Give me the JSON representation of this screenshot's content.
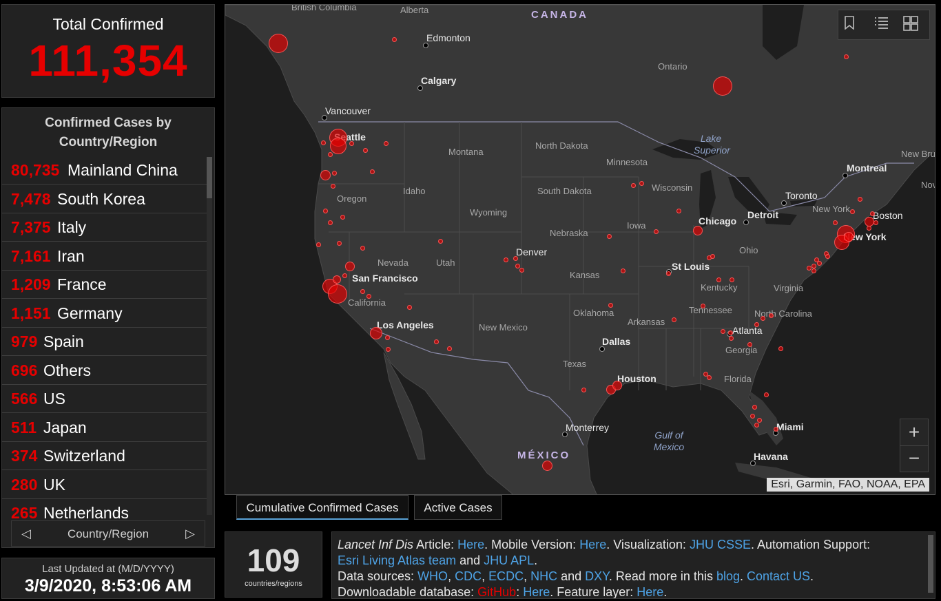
{
  "total": {
    "label": "Total Confirmed",
    "value": "111,354"
  },
  "list": {
    "heading_line1": "Confirmed Cases by",
    "heading_line2": "Country/Region",
    "rows": [
      {
        "num": "80,735",
        "name": "Mainland China"
      },
      {
        "num": "7,478",
        "name": "South Korea"
      },
      {
        "num": "7,375",
        "name": "Italy"
      },
      {
        "num": "7,161",
        "name": "Iran"
      },
      {
        "num": "1,209",
        "name": "France"
      },
      {
        "num": "1,151",
        "name": "Germany"
      },
      {
        "num": "979",
        "name": "Spain"
      },
      {
        "num": "696",
        "name": "Others"
      },
      {
        "num": "566",
        "name": "US"
      },
      {
        "num": "511",
        "name": "Japan"
      },
      {
        "num": "374",
        "name": "Switzerland"
      },
      {
        "num": "280",
        "name": "UK"
      },
      {
        "num": "265",
        "name": "Netherlands"
      }
    ],
    "pager_label": "Country/Region",
    "prev_icon": "◁",
    "next_icon": "▷"
  },
  "updated": {
    "label": "Last Updated at (M/D/YYYY)",
    "value": "3/9/2020, 8:53:06 AM"
  },
  "map": {
    "countries": {
      "canada": "CANADA",
      "mexico": "MÉXICO"
    },
    "regions": {
      "british_columbia": "British Columbia",
      "alberta": "Alberta",
      "ontario": "Ontario",
      "montana": "Montana",
      "north_dakota": "North Dakota",
      "minnesota": "Minnesota",
      "idaho": "Idaho",
      "south_dakota": "South Dakota",
      "wisconsin": "Wisconsin",
      "oregon": "Oregon",
      "wyoming": "Wyoming",
      "iowa": "Iowa",
      "nebraska": "Nebraska",
      "nevada": "Nevada",
      "utah": "Utah",
      "ohio": "Ohio",
      "kansas": "Kansas",
      "kentucky": "Kentucky",
      "virginia": "Virginia",
      "california": "California",
      "tennessee": "Tennessee",
      "north_carolina": "North Carolina",
      "oklahoma": "Oklahoma",
      "arkansas": "Arkansas",
      "new_mexico": "New Mexico",
      "georgia": "Georgia",
      "texas": "Texas",
      "florida": "Florida",
      "new_york_state": "New York",
      "new_brunswick": "New Brunswi",
      "nova": "Nov"
    },
    "cities": {
      "edmonton": "Edmonton",
      "calgary": "Calgary",
      "vancouver": "Vancouver",
      "seattle": "Seattle",
      "montreal": "Montreal",
      "toronto": "Toronto",
      "boston": "Boston",
      "detroit": "Detroit",
      "chicago": "Chicago",
      "new_york": "New York",
      "denver": "Denver",
      "st_louis": "St Louis",
      "san_francisco": "San Francisco",
      "los_angeles": "Los Angeles",
      "dallas": "Dallas",
      "atlanta": "Atlanta",
      "houston": "Houston",
      "monterrey": "Monterrey",
      "miami": "Miami",
      "havana": "Havana"
    },
    "water": {
      "lake_superior": "Lake Superior",
      "gulf_of_mexico": "Gulf of Mexico"
    },
    "attribution": "Esri, Garmin, FAO, NOAA, EPA",
    "tools": {
      "bookmark_icon": "bookmark-icon",
      "list_icon": "list-icon",
      "grid_icon": "basemap-gallery-icon"
    },
    "zoom_in": "+",
    "zoom_out": "−",
    "land_color": "#3a3a3a",
    "water_color": "#1e1e1e",
    "bubble_color": "#e60000"
  },
  "tabs": {
    "cumulative": "Cumulative Confirmed Cases",
    "active": "Active Cases"
  },
  "count": {
    "value": "109",
    "label": "countries/regions"
  },
  "info": {
    "l1_a": "Lancet Inf Dis",
    "l1_b": " Article: ",
    "l1_here1": "Here",
    "l1_c": ". Mobile Version: ",
    "l1_here2": "Here",
    "l1_d": ". Visualization: ",
    "l1_jhu": "JHU CSSE",
    "l1_e": ". Automation Support:",
    "l2_esri": "Esri Living Atlas team",
    "l2_and": " and ",
    "l2_apl": "JHU APL",
    "l2_dot": ".",
    "l3_a": "Data sources: ",
    "l3_who": "WHO",
    "l3_c1": ", ",
    "l3_cdc": "CDC",
    "l3_c2": ", ",
    "l3_ecdc": "ECDC",
    "l3_c3": ", ",
    "l3_nhc": "NHC",
    "l3_and": " and ",
    "l3_dxy": "DXY",
    "l3_b": ". Read more in this ",
    "l3_blog": "blog",
    "l3_c": ". ",
    "l3_contact": "Contact US",
    "l3_d": ".",
    "l4_a": "Downloadable database: ",
    "l4_gh": "GitHub",
    "l4_b": ": ",
    "l4_here": "Here",
    "l4_c": ". Feature layer: ",
    "l4_here2": "Here",
    "l4_d": "."
  }
}
